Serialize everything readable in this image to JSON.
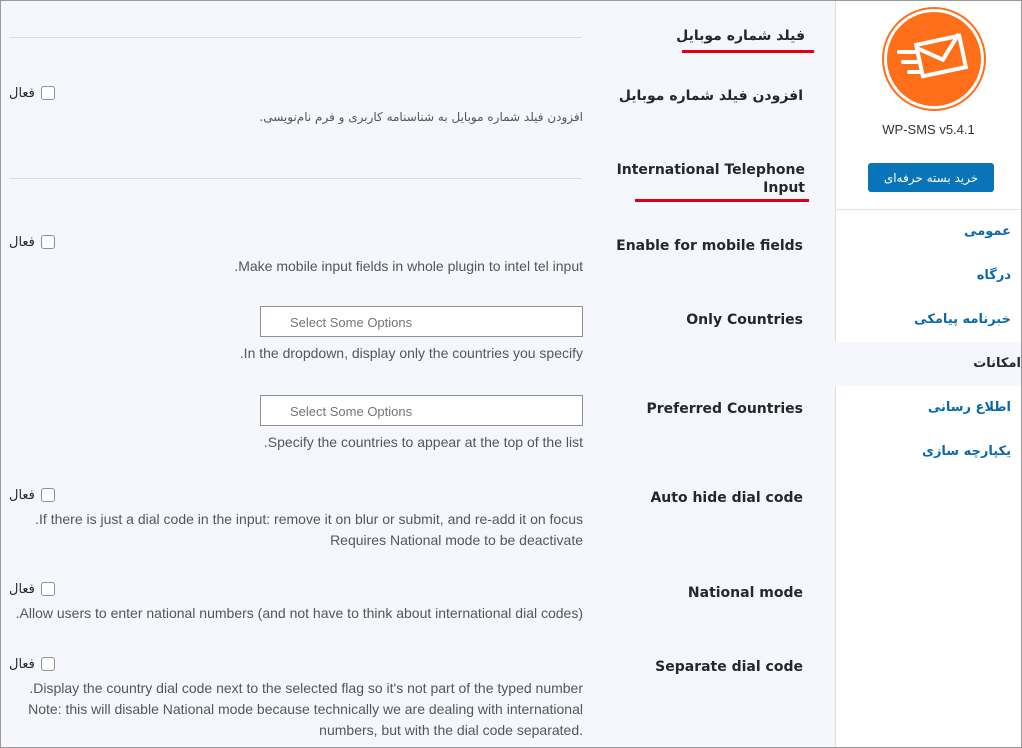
{
  "sidebar": {
    "version": "WP-SMS v5.4.1",
    "buy_label": "خرید بسته حرفه‌ای",
    "items": [
      {
        "label": "عمومی"
      },
      {
        "label": "درگاه"
      },
      {
        "label": "خبرنامه پیامکی"
      },
      {
        "label": "امکانات"
      },
      {
        "label": "اطلاع رسانی"
      },
      {
        "label": "یکپارچه سازی"
      }
    ],
    "active_index": 3
  },
  "sections": {
    "mobile_title": "فیلد شماره موبایل",
    "intl_title": "International Telephone Input"
  },
  "rows": {
    "add_mobile": {
      "label": "افزودن فیلد شماره موبایل",
      "checkbox_label": "فعال",
      "desc": "افزودن فیلد شماره موبایل به شناسنامه کاربری و فرم نام‌نویسی."
    },
    "enable_mobile": {
      "label": "Enable for mobile fields",
      "checkbox_label": "فعال",
      "desc": ".Make mobile input fields in whole plugin to intel tel input"
    },
    "only_countries": {
      "label": "Only Countries",
      "placeholder": "Select Some Options",
      "desc": ".In the dropdown, display only the countries you specify"
    },
    "preferred_countries": {
      "label": "Preferred Countries",
      "placeholder": "Select Some Options",
      "desc": ".Specify the countries to appear at the top of the list"
    },
    "auto_hide": {
      "label": "Auto hide dial code",
      "checkbox_label": "فعال",
      "desc1": ".If there is just a dial code in the input: remove it on blur or submit, and re-add it on focus",
      "desc2": "Requires National mode to be deactivate"
    },
    "national_mode": {
      "label": "National mode",
      "checkbox_label": "فعال",
      "desc": ".Allow users to enter national numbers (and not have to think about international dial codes)"
    },
    "separate_dial": {
      "label": "Separate dial code",
      "checkbox_label": "فعال",
      "desc1": ".Display the country dial code next to the selected flag so it's not part of the typed number",
      "desc2": "Note: this will disable National mode because technically we are dealing with international",
      "desc3": "numbers, but with the dial code separated."
    }
  },
  "colors": {
    "logo": "#ff6f1a",
    "button": "#0a74b8",
    "link": "#0a6aa8",
    "annotation": "#e00012"
  },
  "icons": {
    "logo": "envelope-icon",
    "arrow": "arrow-right-icon"
  }
}
